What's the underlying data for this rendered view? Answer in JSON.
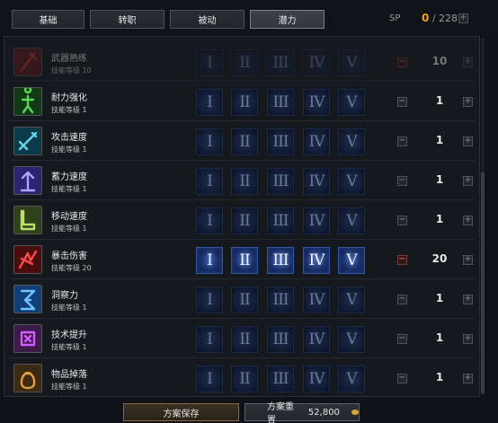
{
  "tabs": [
    "基础",
    "转职",
    "被动",
    "潜力"
  ],
  "active_tab": "潜力",
  "sp": {
    "label": "SP",
    "current": "0",
    "total": "/ 228"
  },
  "controls": {
    "minus": "−",
    "plus": "+"
  },
  "tiers": [
    "I",
    "II",
    "III",
    "IV",
    "V"
  ],
  "skills": [
    {
      "name": "武器熟练",
      "level_text": "技能等级 10",
      "value": "10",
      "icon": "sword-icon",
      "lit": 0,
      "dim": true,
      "minus_active": true
    },
    {
      "name": "耐力强化",
      "level_text": "技能等级 1",
      "value": "1",
      "icon": "figure-icon",
      "lit": 0,
      "dim": false,
      "minus_active": false
    },
    {
      "name": "攻击速度",
      "level_text": "技能等级 1",
      "value": "1",
      "icon": "sword-speed-icon",
      "lit": 0,
      "dim": false,
      "minus_active": false
    },
    {
      "name": "蓄力速度",
      "level_text": "技能等级 1",
      "value": "1",
      "icon": "charge-icon",
      "lit": 0,
      "dim": false,
      "minus_active": false
    },
    {
      "name": "移动速度",
      "level_text": "技能等级 1",
      "value": "1",
      "icon": "boot-icon",
      "lit": 0,
      "dim": false,
      "minus_active": false
    },
    {
      "name": "暴击伤害",
      "level_text": "技能等级 20",
      "value": "20",
      "icon": "crit-icon",
      "lit": 5,
      "dim": false,
      "minus_active": true
    },
    {
      "name": "洞察力",
      "level_text": "技能等级 1",
      "value": "1",
      "icon": "insight-icon",
      "lit": 0,
      "dim": false,
      "minus_active": false
    },
    {
      "name": "技术提升",
      "level_text": "技能等级 1",
      "value": "1",
      "icon": "tech-icon",
      "lit": 0,
      "dim": false,
      "minus_active": false
    },
    {
      "name": "物品掉落",
      "level_text": "技能等级 1",
      "value": "1",
      "icon": "loot-bag-icon",
      "lit": 0,
      "dim": false,
      "minus_active": false
    }
  ],
  "footer": {
    "save_label": "方案保存",
    "reset_label": "方案重置",
    "reset_cost": "52,800",
    "currency_icon": "gold-coin-icon"
  },
  "colors": {
    "accent": "#f0a01e",
    "tier_lit": "#f4f7ff",
    "tier_dim": "#6d7a94"
  }
}
